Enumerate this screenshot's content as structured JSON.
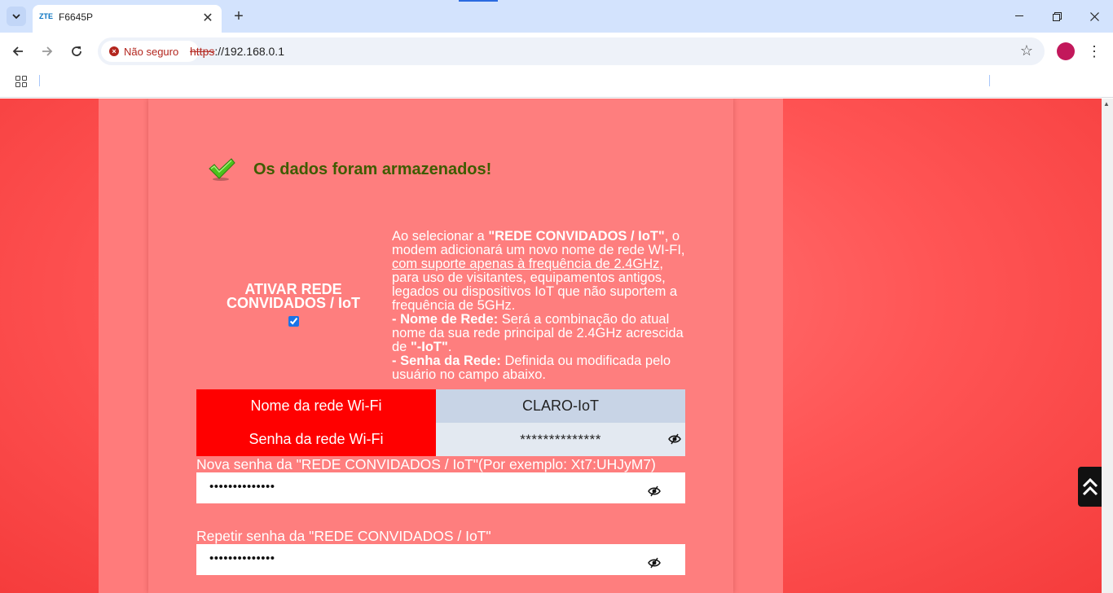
{
  "browser": {
    "tab": {
      "favicon_text": "ZTE",
      "title": "F6645P"
    },
    "security_label": "Não seguro",
    "url_scheme": "https",
    "url_rest": "://192.168.0.1"
  },
  "page": {
    "success_message": "Os dados foram armazenados!",
    "activate": {
      "label_line1": "ATIVAR REDE",
      "label_line2": "CONVIDADOS / IoT",
      "checked": true
    },
    "description": {
      "p1_a": "Ao selecionar a ",
      "p1_b": "\"REDE CONVIDADOS / IoT\"",
      "p1_c": ", o modem adicionará um novo nome de rede WI-FI, ",
      "p1_u": "com suporte apenas à frequência de 2.4GHz",
      "p1_d": ", para uso de visitantes, equipamentos antigos, legados ou dispositivos IoT que não suportem a frequência de 5GHz.",
      "p2_b": "- Nome de Rede:",
      "p2_a": " Será a combinação do atual nome da sua rede principal de 2.4GHz acrescida de ",
      "p2_c": "\"-IoT\"",
      "p2_d": ".",
      "p3_b": "- Senha da Rede:",
      "p3_a": " Definida ou modificada pelo usuário no campo abaixo."
    },
    "network_table": {
      "ssid_label": "Nome da rede Wi-Fi",
      "ssid_value": "CLARO-IoT",
      "password_label": "Senha da rede Wi-Fi",
      "password_value": "**************"
    },
    "new_password": {
      "label": "Nova senha da \"REDE CONVIDADOS / IoT\"(Por exemplo: Xt7:UHJyM7)",
      "value": "••••••••••••••"
    },
    "repeat_password": {
      "label": "Repetir senha da \"REDE CONVIDADOS / IoT\"",
      "value": "••••••••••••••"
    }
  },
  "colors": {
    "background": "#ff5555",
    "panel": "#fe7e7e",
    "label_red": "#ff0000",
    "success_text": "#3e5c00"
  }
}
